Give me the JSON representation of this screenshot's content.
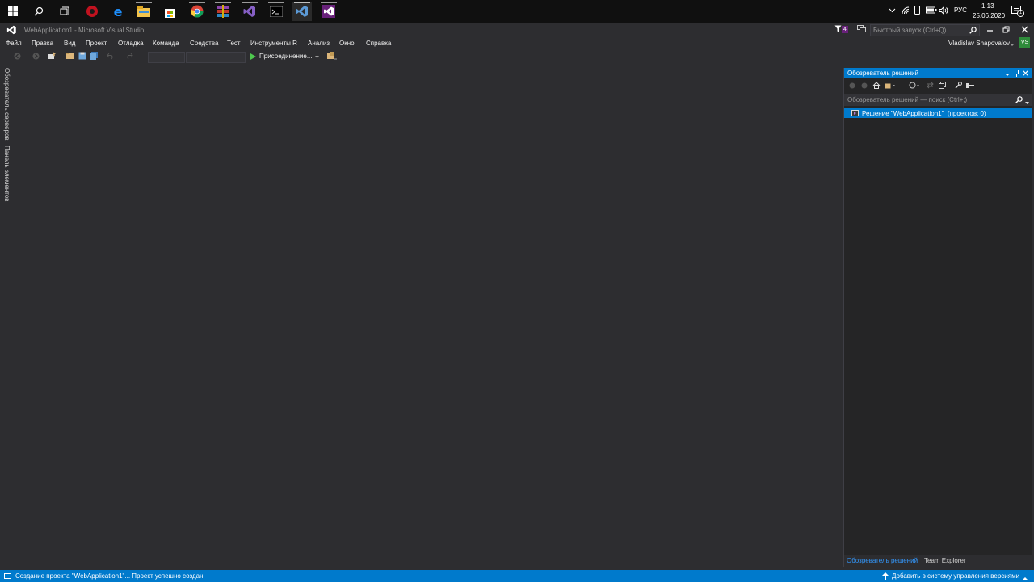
{
  "taskbar": {
    "icons": [
      "windows-start-icon",
      "search-icon",
      "task-view-icon",
      "red-app-icon",
      "edge-icon",
      "file-explorer-icon",
      "store-icon",
      "chrome-icon",
      "winrar-icon",
      "visual-studio-icon",
      "terminal-icon",
      "visual-studio-active-icon",
      "visual-studio-2-icon"
    ],
    "language": "РУС",
    "time": "1:13",
    "date": "25.06.2020",
    "notification_count": "1"
  },
  "window": {
    "title": "WebApplication1 - Microsoft Visual Studio",
    "notifications_badge": "4",
    "quick_launch_placeholder": "Быстрый запуск (Ctrl+Q)",
    "user_name": "Vladislav Shapovalov",
    "user_initials": "VS"
  },
  "menu": {
    "items": [
      "Файл",
      "Правка",
      "Вид",
      "Проект",
      "Отладка",
      "Команда",
      "Средства",
      "Тест",
      "Инструменты R",
      "Анализ",
      "Окно",
      "Справка"
    ]
  },
  "toolbar": {
    "attach_label": "Присоединение..."
  },
  "side_tabs": {
    "server_explorer": "Обозреватель серверов",
    "toolbox": "Панель элементов"
  },
  "solution_explorer": {
    "title": "Обозреватель решений",
    "search_placeholder": "Обозреватель решений — поиск (Ctrl+;)",
    "solution_item": "Решение \"WebApplication1\"  (проектов: 0)",
    "tab_solution": "Обозреватель решений",
    "tab_team": "Team Explorer"
  },
  "status": {
    "message": "Создание проекта \"WebApplication1\"... Проект успешно создан.",
    "source_control": "Добавить в систему управления версиями"
  },
  "colors": {
    "accent": "#007acc",
    "vs_purple": "#68217a",
    "background": "#2d2d30"
  }
}
